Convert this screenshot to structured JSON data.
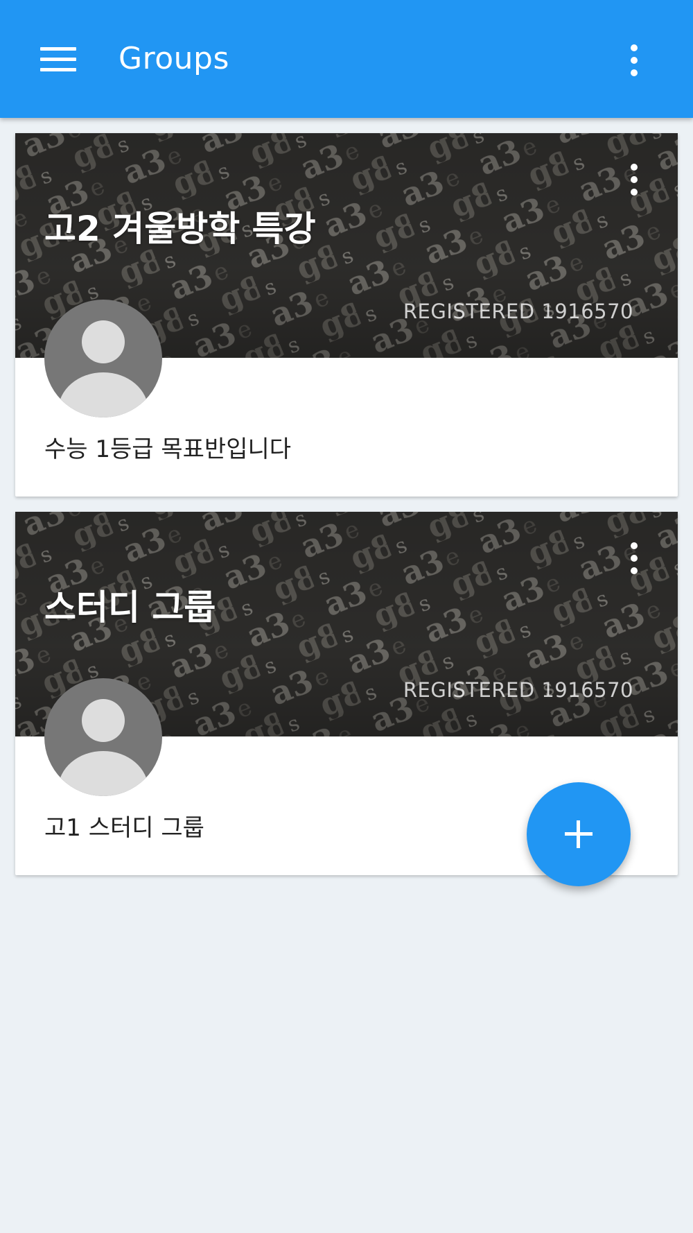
{
  "app_bar": {
    "title": "Groups",
    "menu_icon": "hamburger-menu-icon",
    "overflow_icon": "more-vert-icon",
    "color": "#2196f3"
  },
  "groups": [
    {
      "title": "고2 겨울방학 특강",
      "watermark": "REGISTERED 1916570",
      "description": "수능 1등급 목표반입니다",
      "avatar_icon": "default-avatar-icon",
      "overflow_icon": "more-vert-icon"
    },
    {
      "title": "스터디 그룹",
      "watermark": "REGISTERED 1916570",
      "description": "고1 스터디 그룹",
      "avatar_icon": "default-avatar-icon",
      "overflow_icon": "more-vert-icon"
    }
  ],
  "fab": {
    "icon": "add-icon",
    "color": "#2196f3"
  },
  "background_color": "#ecf1f5"
}
